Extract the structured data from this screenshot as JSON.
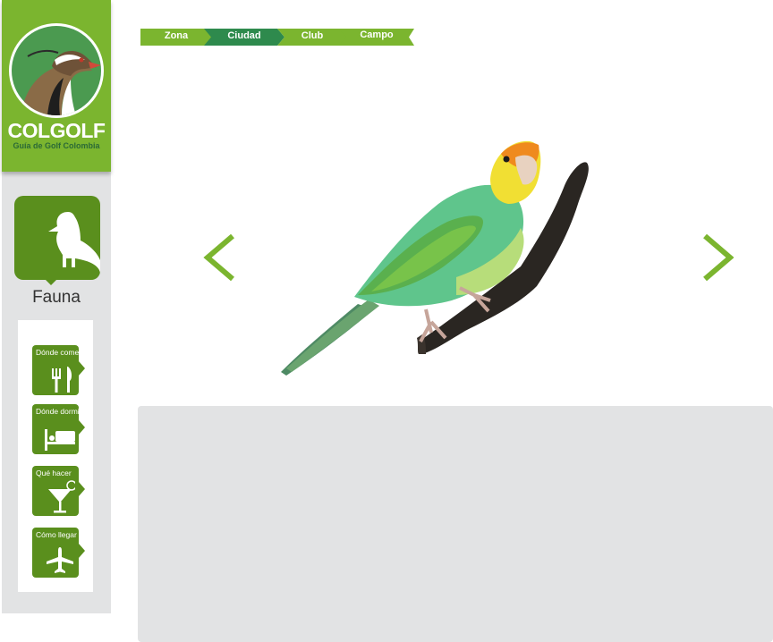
{
  "logo": {
    "name": "COLGOLF",
    "tagline": "Guía de Golf Colombia"
  },
  "section": {
    "label": "Fauna",
    "icon": "bird-icon"
  },
  "menu": [
    {
      "label": "Dónde comer",
      "icon": "fork-knife-icon"
    },
    {
      "label": "Dónde dormir",
      "icon": "bed-icon"
    },
    {
      "label": "Qué hacer",
      "icon": "cocktail-icon"
    },
    {
      "label": "Cómo llegar",
      "icon": "airplane-icon"
    }
  ],
  "breadcrumb": [
    {
      "label": "Zona"
    },
    {
      "label": "Ciudad"
    },
    {
      "label": "Club"
    },
    {
      "label": "Campo"
    }
  ],
  "gallery": {
    "prev_icon": "chevron-left-icon",
    "next_icon": "chevron-right-icon",
    "image": "parrot-photo"
  },
  "colors": {
    "brand_green": "#7bb52f",
    "tile_green": "#5a8f1d",
    "crumb_light": "#7bb52f",
    "crumb_dark": "#2e8a4d",
    "panel_gray": "#e2e3e4"
  }
}
